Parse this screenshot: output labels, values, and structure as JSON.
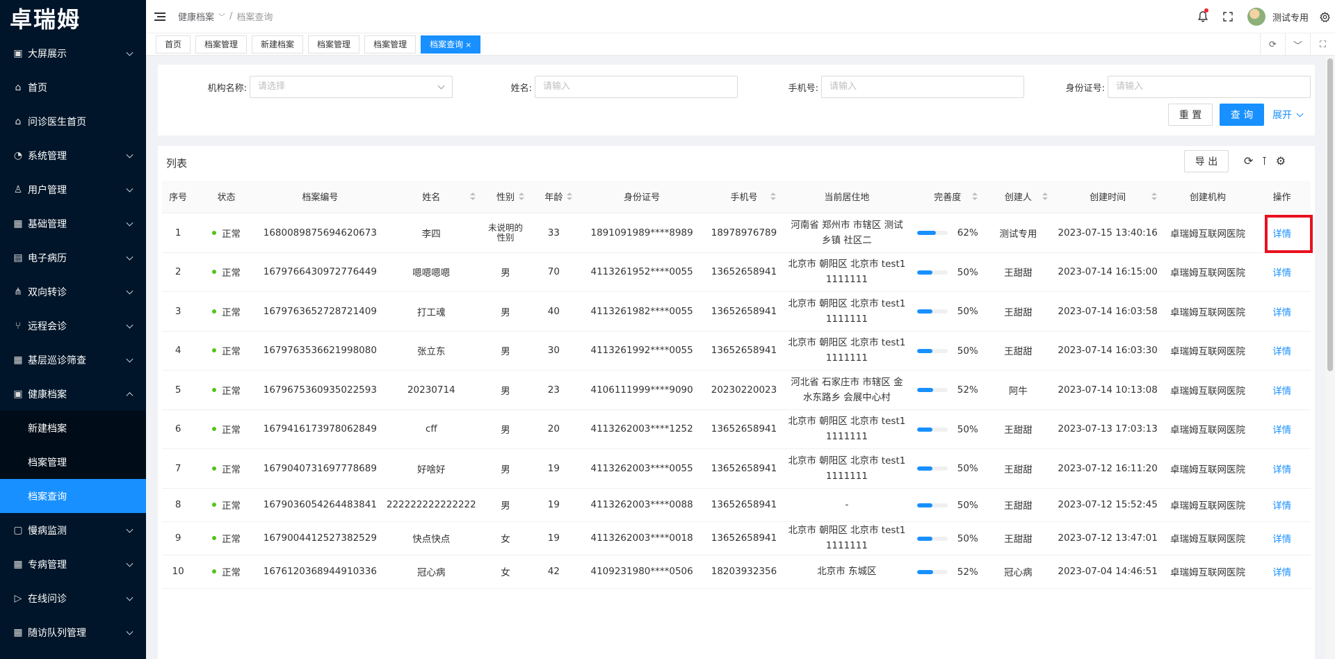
{
  "sidebar": {
    "logo": "卓瑞姆",
    "items": [
      {
        "label": "大屏展示",
        "icon": "dashboard-icon",
        "chevron": true
      },
      {
        "label": "首页",
        "icon": "home-icon",
        "chevron": false
      },
      {
        "label": "问诊医生首页",
        "icon": "home-icon",
        "chevron": false
      },
      {
        "label": "系统管理",
        "icon": "gauge-icon",
        "chevron": true
      },
      {
        "label": "用户管理",
        "icon": "user-icon",
        "chevron": true
      },
      {
        "label": "基础管理",
        "icon": "calendar-icon",
        "chevron": true
      },
      {
        "label": "电子病历",
        "icon": "record-icon",
        "chevron": true
      },
      {
        "label": "双向转诊",
        "icon": "share-icon",
        "chevron": true
      },
      {
        "label": "远程会诊",
        "icon": "branch-icon",
        "chevron": true
      },
      {
        "label": "基层巡诊筛查",
        "icon": "calendar-icon",
        "chevron": true
      },
      {
        "label": "健康档案",
        "icon": "folder-icon",
        "chevron": true,
        "expanded": true
      },
      {
        "label": "新建档案",
        "sub": true
      },
      {
        "label": "档案管理",
        "sub": true
      },
      {
        "label": "档案查询",
        "sub": true,
        "active": true
      },
      {
        "label": "慢病监测",
        "icon": "monitor-icon",
        "chevron": true
      },
      {
        "label": "专病管理",
        "icon": "calendar-icon",
        "chevron": true
      },
      {
        "label": "在线问诊",
        "icon": "send-icon",
        "chevron": true
      },
      {
        "label": "随访队列管理",
        "icon": "grid-icon",
        "chevron": true
      }
    ]
  },
  "header": {
    "breadcrumb_parent": "健康档案",
    "breadcrumb_sep": "/",
    "breadcrumb_current": "档案查询",
    "user_name": "测试专用"
  },
  "tabs": [
    {
      "label": "首页"
    },
    {
      "label": "档案管理"
    },
    {
      "label": "新建档案"
    },
    {
      "label": "档案管理"
    },
    {
      "label": "档案管理"
    },
    {
      "label": "档案查询",
      "active": true,
      "close": "×"
    }
  ],
  "search": {
    "org_label": "机构名称:",
    "org_placeholder": "请选择",
    "name_label": "姓名:",
    "name_placeholder": "请输入",
    "phone_label": "手机号:",
    "phone_placeholder": "请输入",
    "id_label": "身份证号:",
    "id_placeholder": "请输入",
    "reset_label": "重 置",
    "query_label": "查 询",
    "expand_label": "展开"
  },
  "table": {
    "title": "列表",
    "export_label": "导 出",
    "columns": [
      "序号",
      "状态",
      "档案编号",
      "姓名",
      "性别",
      "年龄",
      "身份证号",
      "手机号",
      "当前居住地",
      "完善度",
      "创建人",
      "创建时间",
      "创建机构",
      "操作"
    ],
    "rows": [
      {
        "no": "1",
        "status": "正常",
        "file_no": "1680089875694620673",
        "name": "李四",
        "gender": "未说明的性别",
        "age": "33",
        "id_card": "1891091989****8989",
        "phone": "18978976789",
        "address": "河南省 郑州市 市辖区 测试乡镇 社区二",
        "progress": 62,
        "progress_text": "62%",
        "creator": "测试专用",
        "created": "2023-07-15 13:40:16",
        "org": "卓瑞姆互联网医院",
        "action": "详情"
      },
      {
        "no": "2",
        "status": "正常",
        "file_no": "1679766430972776449",
        "name": "嗯嗯嗯嗯",
        "gender": "男",
        "age": "70",
        "id_card": "4113261952****0055",
        "phone": "13652658941",
        "address": "北京市 朝阳区 北京市 test1 1111111",
        "progress": 50,
        "progress_text": "50%",
        "creator": "王甜甜",
        "created": "2023-07-14 16:15:00",
        "org": "卓瑞姆互联网医院",
        "action": "详情"
      },
      {
        "no": "3",
        "status": "正常",
        "file_no": "1679763652728721409",
        "name": "打工魂",
        "gender": "男",
        "age": "40",
        "id_card": "4113261982****0055",
        "phone": "13652658941",
        "address": "北京市 朝阳区 北京市 test1 1111111",
        "progress": 50,
        "progress_text": "50%",
        "creator": "王甜甜",
        "created": "2023-07-14 16:03:58",
        "org": "卓瑞姆互联网医院",
        "action": "详情"
      },
      {
        "no": "4",
        "status": "正常",
        "file_no": "1679763536621998080",
        "name": "张立东",
        "gender": "男",
        "age": "30",
        "id_card": "4113261992****0055",
        "phone": "13652658941",
        "address": "北京市 朝阳区 北京市 test1 1111111",
        "progress": 50,
        "progress_text": "50%",
        "creator": "王甜甜",
        "created": "2023-07-14 16:03:30",
        "org": "卓瑞姆互联网医院",
        "action": "详情"
      },
      {
        "no": "5",
        "status": "正常",
        "file_no": "1679675360935022593",
        "name": "20230714",
        "gender": "男",
        "age": "23",
        "id_card": "4106111999****9090",
        "phone": "20230220023",
        "address": "河北省 石家庄市 市辖区 金水东路乡 会展中心村",
        "progress": 52,
        "progress_text": "52%",
        "creator": "阿牛",
        "created": "2023-07-14 10:13:08",
        "org": "卓瑞姆互联网医院",
        "action": "详情"
      },
      {
        "no": "6",
        "status": "正常",
        "file_no": "1679416173978062849",
        "name": "cff",
        "gender": "男",
        "age": "20",
        "id_card": "4113262003****1252",
        "phone": "13652658941",
        "address": "北京市 朝阳区 北京市 test1 1111111",
        "progress": 50,
        "progress_text": "50%",
        "creator": "王甜甜",
        "created": "2023-07-13 17:03:13",
        "org": "卓瑞姆互联网医院",
        "action": "详情"
      },
      {
        "no": "7",
        "status": "正常",
        "file_no": "1679040731697778689",
        "name": "好啥好",
        "gender": "男",
        "age": "19",
        "id_card": "4113262003****0055",
        "phone": "13652658941",
        "address": "北京市 朝阳区 北京市 test1 1111111",
        "progress": 50,
        "progress_text": "50%",
        "creator": "王甜甜",
        "created": "2023-07-12 16:11:20",
        "org": "卓瑞姆互联网医院",
        "action": "详情"
      },
      {
        "no": "8",
        "status": "正常",
        "file_no": "1679036054264483841",
        "name": "222222222222222",
        "gender": "男",
        "age": "19",
        "id_card": "4113262003****0088",
        "phone": "13652658941",
        "address": "-",
        "progress": 50,
        "progress_text": "50%",
        "creator": "王甜甜",
        "created": "2023-07-12 15:52:45",
        "org": "卓瑞姆互联网医院",
        "action": "详情"
      },
      {
        "no": "9",
        "status": "正常",
        "file_no": "1679004412527382529",
        "name": "快点快点",
        "gender": "女",
        "age": "19",
        "id_card": "4113262003****0018",
        "phone": "13652658941",
        "address": "北京市 朝阳区 北京市 test1 1111111",
        "progress": 50,
        "progress_text": "50%",
        "creator": "王甜甜",
        "created": "2023-07-12 13:47:01",
        "org": "卓瑞姆互联网医院",
        "action": "详情"
      },
      {
        "no": "10",
        "status": "正常",
        "file_no": "1676120368944910336",
        "name": "冠心病",
        "gender": "女",
        "age": "42",
        "id_card": "4109231980****0506",
        "phone": "18203932356",
        "address": "北京市 东城区",
        "progress": 52,
        "progress_text": "52%",
        "creator": "冠心病",
        "created": "2023-07-04 14:46:51",
        "org": "卓瑞姆互联网医院",
        "action": "详情"
      }
    ]
  }
}
